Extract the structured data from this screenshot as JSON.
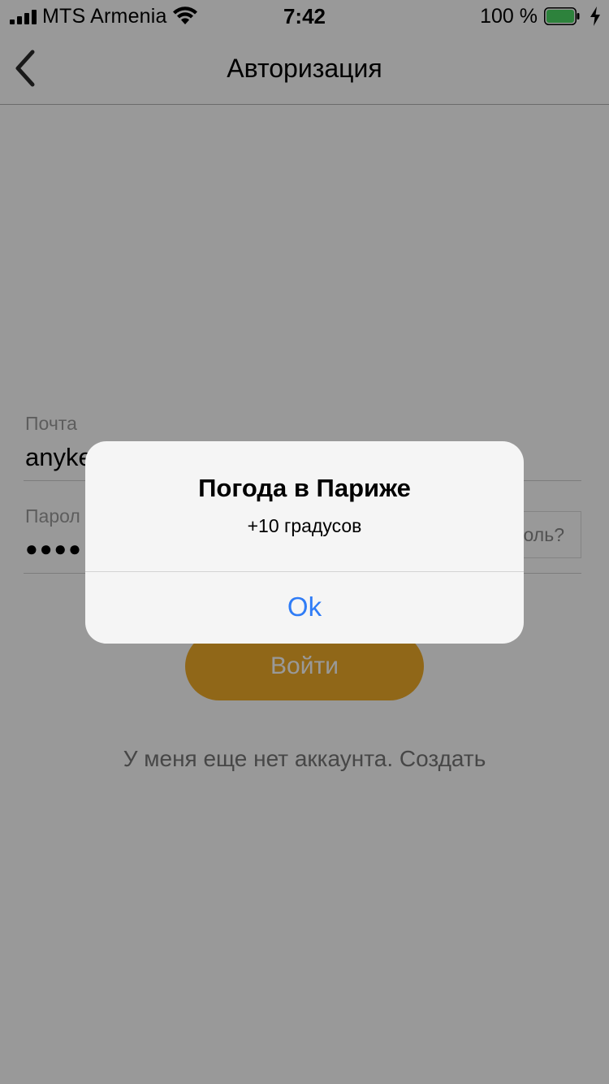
{
  "status_bar": {
    "carrier": "MTS Armenia",
    "time": "7:42",
    "battery_percent": "100 %",
    "signal_icon": "signal-bars-icon",
    "wifi_icon": "wifi-icon",
    "battery_icon": "battery-full-icon",
    "charging_icon": "charging-bolt-icon"
  },
  "nav": {
    "title": "Авторизация",
    "back_icon": "chevron-left-icon"
  },
  "form": {
    "email_label": "Почта",
    "email_value": "anyke",
    "password_label": "Парол",
    "password_value": "●●●●",
    "forgot_label": "оль?",
    "login_button": "Войти",
    "register_link": "У меня еще нет аккаунта. Создать"
  },
  "alert": {
    "title": "Погода в Париже",
    "message": "+10 градусов",
    "ok_label": "Ok"
  },
  "colors": {
    "accent_button": "#f1ac29",
    "alert_action": "#2f7cf6",
    "overlay": "rgba(0,0,0,0.40)",
    "battery_fill": "#4cd964"
  }
}
